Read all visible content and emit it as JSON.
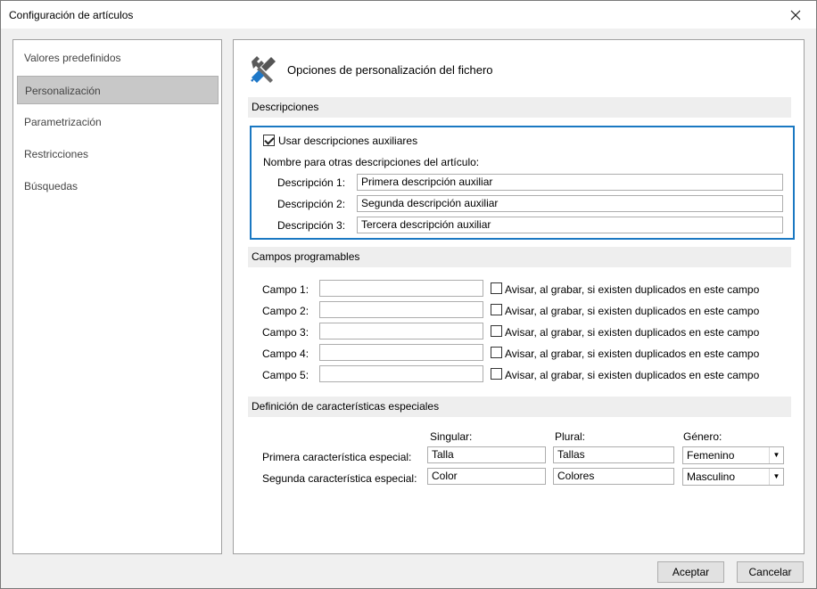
{
  "window": {
    "title": "Configuración de artículos"
  },
  "nav": {
    "items": [
      {
        "label": "Valores predefinidos"
      },
      {
        "label": "Personalización"
      },
      {
        "label": "Parametrización"
      },
      {
        "label": "Restricciones"
      },
      {
        "label": "Búsquedas"
      }
    ],
    "active_index": 1
  },
  "content": {
    "header_title": "Opciones de personalización del fichero",
    "descripciones": {
      "section_title": "Descripciones",
      "checkbox_label": "Usar descripciones auxiliares",
      "checkbox_checked": true,
      "subheading": "Nombre para otras descripciones del artículo:",
      "rows": [
        {
          "label": "Descripción 1:",
          "value": "Primera descripción auxiliar"
        },
        {
          "label": "Descripción 2:",
          "value": "Segunda descripción auxiliar"
        },
        {
          "label": "Descripción 3:",
          "value": "Tercera descripción auxiliar"
        }
      ]
    },
    "campos": {
      "section_title": "Campos programables",
      "rows": [
        {
          "label": "Campo 1:",
          "value": "",
          "checkbox_label": "Avisar, al grabar, si existen duplicados en este campo",
          "checked": false
        },
        {
          "label": "Campo 2:",
          "value": "",
          "checkbox_label": "Avisar, al grabar, si existen duplicados en este campo",
          "checked": false
        },
        {
          "label": "Campo 3:",
          "value": "",
          "checkbox_label": "Avisar, al grabar, si existen duplicados en este campo",
          "checked": false
        },
        {
          "label": "Campo 4:",
          "value": "",
          "checkbox_label": "Avisar, al grabar, si existen duplicados en este campo",
          "checked": false
        },
        {
          "label": "Campo 5:",
          "value": "",
          "checkbox_label": "Avisar, al grabar, si existen duplicados en este campo",
          "checked": false
        }
      ]
    },
    "caracteristicas": {
      "section_title": "Definición de características especiales",
      "col_singular": "Singular:",
      "col_plural": "Plural:",
      "col_genero": "Género:",
      "rows": [
        {
          "label": "Primera característica especial:",
          "singular": "Talla",
          "plural": "Tallas",
          "genero": "Femenino"
        },
        {
          "label": "Segunda característica especial:",
          "singular": "Color",
          "plural": "Colores",
          "genero": "Masculino"
        }
      ]
    }
  },
  "buttons": {
    "accept": "Aceptar",
    "cancel": "Cancelar"
  },
  "icons": {
    "close": "close-icon",
    "header": "tools-icon",
    "dropdown": "chevron-down-icon"
  }
}
